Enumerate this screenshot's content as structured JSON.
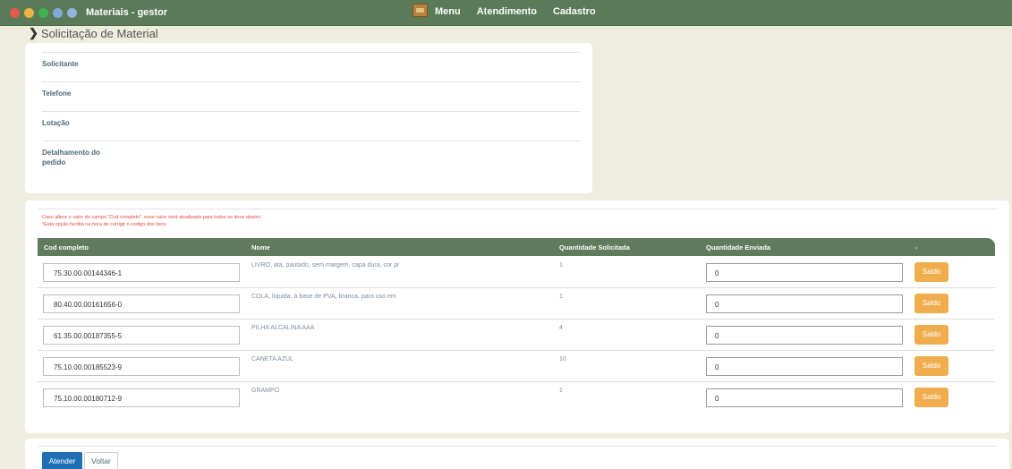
{
  "window": {
    "title": "Materiais - gestor"
  },
  "topnav": {
    "menu_icon": "menu-box-icon",
    "items": [
      {
        "label": "Menu"
      },
      {
        "label": "Atendimento"
      },
      {
        "label": "Cadastro"
      }
    ]
  },
  "breadcrumb": {
    "icon": "chevron-right-icon",
    "title": "Solicitação de Material"
  },
  "form": {
    "fields": [
      {
        "label": "Solicitante"
      },
      {
        "label": "Telefone"
      },
      {
        "label": "Lotação"
      },
      {
        "label": "Detalhamento do pedido"
      }
    ]
  },
  "notes": [
    "Caso altere o valor do campo \"Cod completo\", esse valor será atualizado para todos os itens abaixo.",
    "*Está opção facilita na hora de corrigir o codigo dos itens"
  ],
  "table": {
    "headers": [
      "Cod completo",
      "Nome",
      "Quantidade Solicitada",
      "Quantidade Enviada",
      "-"
    ],
    "rows": [
      {
        "code": "75.30.00.00144346-1",
        "nome": "LIVRO, ata, pautado, sem margem, capa dura, cor pr",
        "qtd_solicitada": "1",
        "qtd_enviada": "0",
        "action": "Saldo"
      },
      {
        "code": "80.40.00.00161656-0",
        "nome": "COLA, líquida, à base de PVA, branca, para uso em",
        "qtd_solicitada": "1",
        "qtd_enviada": "0",
        "action": "Saldo"
      },
      {
        "code": "61.35.00.00187355-5",
        "nome": "PILHA ALCALINA AAA",
        "qtd_solicitada": "4",
        "qtd_enviada": "0",
        "action": "Saldo"
      },
      {
        "code": "75.10.00.00185523-9",
        "nome": "CANETA AZUL",
        "qtd_solicitada": "10",
        "qtd_enviada": "0",
        "action": "Saldo"
      },
      {
        "code": "75.10.00.00180712-9",
        "nome": "GRAMPO",
        "qtd_solicitada": "1",
        "qtd_enviada": "0",
        "action": "Saldo"
      }
    ]
  },
  "actions": {
    "atender": "Atender",
    "voltar": "Voltar"
  },
  "colors": {
    "header_green": "#5a7a58",
    "table_header": "#5f7a5d",
    "saldo_orange": "#f0ad4e",
    "primary_blue": "#1f6fb5",
    "note_red": "#e0493c"
  }
}
